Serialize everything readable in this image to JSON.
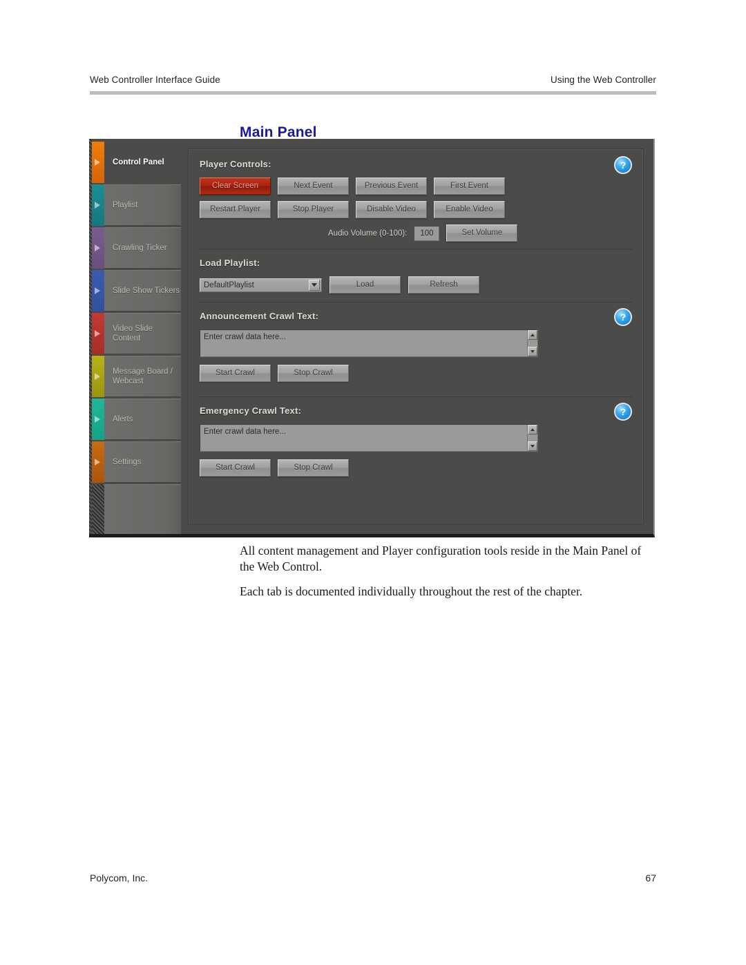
{
  "page": {
    "header_left": "Web Controller Interface Guide",
    "header_right": "Using the Web Controller",
    "section_title": "Main Panel",
    "footer_left": "Polycom, Inc.",
    "footer_right": "67",
    "body_paragraphs": [
      "All content management and Player configuration tools reside in the Main Panel of the Web Control.",
      "Each tab is documented individually throughout the rest of the chapter."
    ]
  },
  "app": {
    "tabs": [
      {
        "label": "Control Panel",
        "color": "#f07d0a",
        "color2": "#d4650a",
        "active": true
      },
      {
        "label": "Playlist",
        "color": "#1b8e96",
        "color2": "#17787f",
        "active": false
      },
      {
        "label": "Crawling Ticker",
        "color": "#7a5d8e",
        "color2": "#6a4f7d",
        "active": false
      },
      {
        "label": "Slide Show Tickers",
        "color": "#3c5bb0",
        "color2": "#32509e",
        "active": false
      },
      {
        "label": "Video Slide Content",
        "color": "#c23a33",
        "color2": "#a52d26",
        "active": false
      },
      {
        "label": "Message Board /\nWebcast",
        "color": "#b8b216",
        "color2": "#9a9410",
        "active": false
      },
      {
        "label": "Alerts",
        "color": "#1fb89a",
        "color2": "#17a286",
        "active": false
      },
      {
        "label": "Settings",
        "color": "#c96b14",
        "color2": "#a8550c",
        "active": false
      }
    ],
    "player_controls": {
      "title": "Player Controls:",
      "help_glyph": "?",
      "buttons_row1": [
        "Clear Screen",
        "Next Event",
        "Previous Event",
        "First Event"
      ],
      "buttons_row2": [
        "Restart Player",
        "Stop Player",
        "Disable Video",
        "Enable Video"
      ],
      "volume_label": "Audio Volume (0-100):",
      "volume_value": "100",
      "set_volume_label": "Set Volume"
    },
    "load_playlist": {
      "title": "Load Playlist:",
      "selected_playlist": "DefaultPlaylist",
      "load_label": "Load",
      "refresh_label": "Refresh"
    },
    "announcement_crawl": {
      "title": "Announcement Crawl Text:",
      "help_glyph": "?",
      "textarea_value": "Enter crawl data here...",
      "start_label": "Start Crawl",
      "stop_label": "Stop Crawl"
    },
    "emergency_crawl": {
      "title": "Emergency Crawl Text:",
      "help_glyph": "?",
      "textarea_value": "Enter crawl data here...",
      "start_label": "Start Crawl",
      "stop_label": "Stop Crawl"
    }
  }
}
